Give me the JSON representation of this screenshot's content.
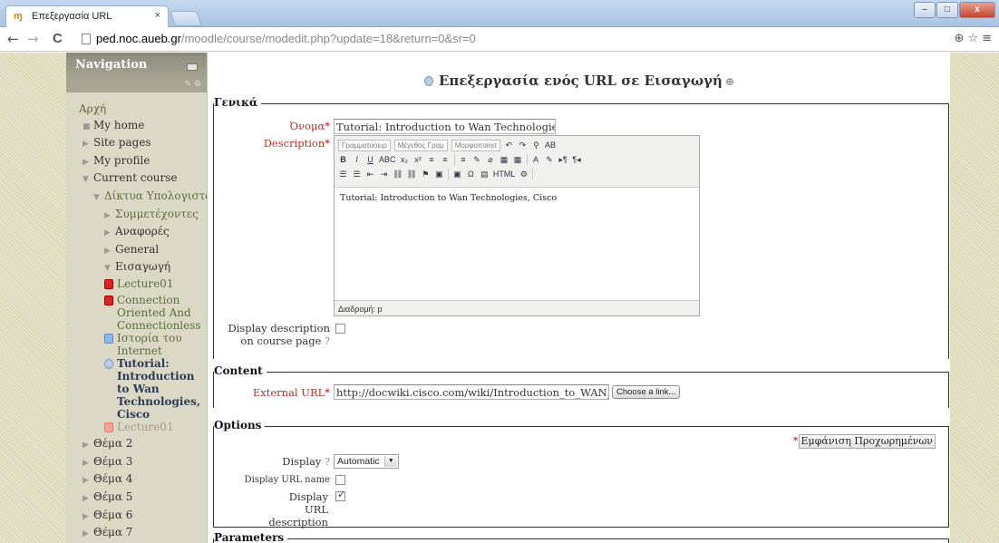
{
  "browser": {
    "tab_title": "Επεξεργασία URL",
    "tab_favicon": "moodle-favicon",
    "tab_close": "×",
    "url_host": "ped.noc.aueb.gr",
    "url_path": "/moodle/course/modedit.php?update=18&return=0&sr=0",
    "win_minimize": "–",
    "win_maximize": "□",
    "win_close": "x",
    "back": "←",
    "forward": "→",
    "reload": "C",
    "right_icons": "⊕☆≡"
  },
  "navigation": {
    "title": "Navigation",
    "sub_icons": "✎ ⚙",
    "root": "Αρχή",
    "items": [
      {
        "label": "My home",
        "level": "l1",
        "marker": "■",
        "style": ""
      },
      {
        "label": "Site pages",
        "level": "l1",
        "marker": "▶",
        "style": ""
      },
      {
        "label": "My profile",
        "level": "l1",
        "marker": "▶",
        "style": ""
      },
      {
        "label": "Current course",
        "level": "l1",
        "marker": "▼",
        "style": ""
      },
      {
        "label": "Δίκτυα Υπολογιστών",
        "level": "l2",
        "marker": "▼",
        "style": "link"
      },
      {
        "label": "Συμμετέχοντες",
        "level": "l3",
        "marker": "▶",
        "style": "link"
      },
      {
        "label": "Αναφορές",
        "level": "l3",
        "marker": "▶",
        "style": ""
      },
      {
        "label": "General",
        "level": "l3",
        "marker": "▶",
        "style": ""
      },
      {
        "label": "Εισαγωγή",
        "level": "l3",
        "marker": "▼",
        "style": ""
      }
    ],
    "activities": [
      {
        "label": "Lecture01",
        "icon": "pdf",
        "style": "link"
      },
      {
        "label": "Connection Oriented And Connectionless",
        "icon": "pdf",
        "style": "link"
      },
      {
        "label": "Ιστορία του Internet",
        "icon": "html",
        "style": "link"
      },
      {
        "label": "Tutorial: Introduction to Wan Technologies, Cisco",
        "icon": "url",
        "style": "current"
      },
      {
        "label": "Lecture01",
        "icon": "pdfdim",
        "style": "dim"
      }
    ],
    "topics": [
      "Θέμα 2",
      "Θέμα 3",
      "Θέμα 4",
      "Θέμα 5",
      "Θέμα 6",
      "Θέμα 7"
    ]
  },
  "main": {
    "title": "Επεξεργασία ενός URL σε Εισαγωγή",
    "help_icon": "⊕"
  },
  "general": {
    "legend": "Γενικά",
    "name_label": "Όνομα",
    "name_value": "Tutorial: Introduction to Wan Technologies, Cisc",
    "description_label": "Description",
    "required_mark": "*",
    "editor": {
      "font_family": "Γραμματοσειρ",
      "font_size": "Μέγεθος Γραμ",
      "format": "Μορφοποίησ",
      "row1_buttons": [
        "↶",
        "↷",
        "⚲",
        "AB"
      ],
      "row2_buttons": [
        "B",
        "I",
        "U",
        "ABC",
        "x₂",
        "x²",
        "≡",
        "≡",
        "≡",
        "✎",
        "⌀",
        "▦",
        "▦",
        "A",
        "✎",
        "▸¶",
        "¶◂"
      ],
      "row3_buttons": [
        "☰",
        "☰",
        "⇤",
        "⇥",
        "⛓",
        "⛓",
        "⚑",
        "▣",
        "▣",
        "Ω",
        "▤",
        "HTML",
        "⚙"
      ],
      "content": "Tutorial: Introduction to Wan Technologies, Cisco",
      "path": "Διαδρομή: p"
    },
    "display_desc_label": "Display description on course page",
    "help": "?",
    "display_desc_checked": false
  },
  "content": {
    "legend": "Content",
    "url_label": "External URL",
    "url_value": "http://docwiki.cisco.com/wiki/Introduction_to_WAN_Tec",
    "choose_button": "Choose a link..."
  },
  "options": {
    "legend": "Options",
    "advanced_star": "*",
    "advanced_button": "Εμφάνιση Προχωρημένων",
    "display_label": "Display",
    "display_value": "Automatic",
    "display_url_name_label": "Display URL name",
    "display_url_name_checked": false,
    "display_url_desc_label": "Display URL description",
    "display_url_desc_checked": true
  },
  "parameters": {
    "legend": "Parameters"
  }
}
